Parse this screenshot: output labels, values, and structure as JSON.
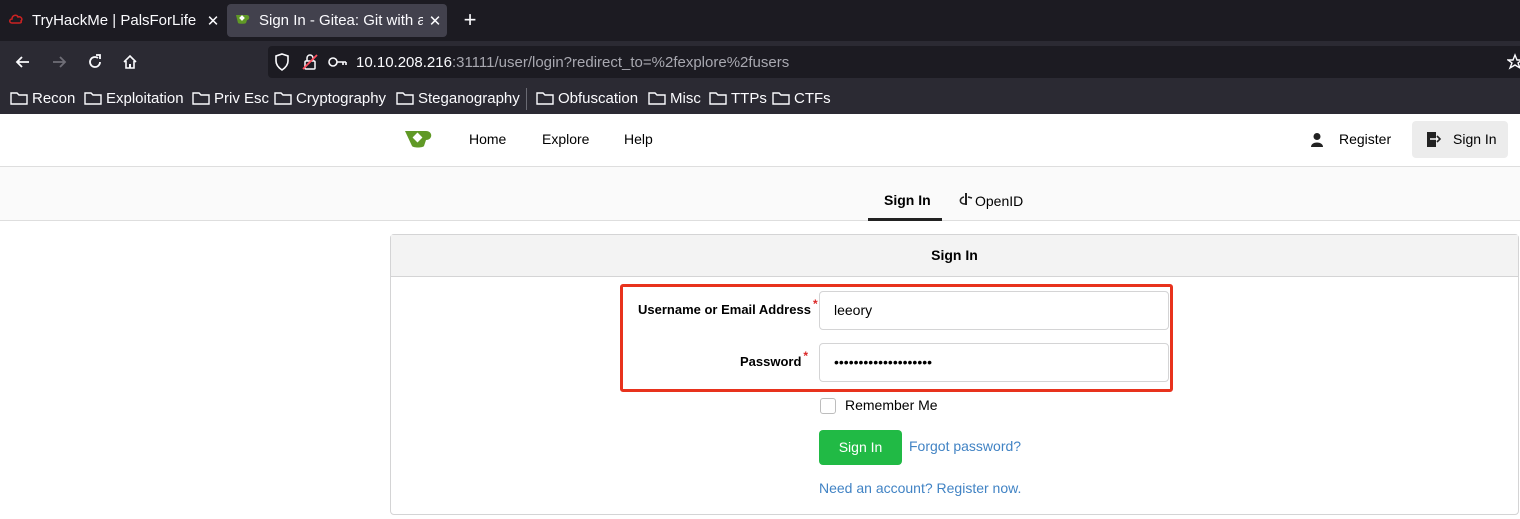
{
  "browser": {
    "tabs": [
      {
        "title": "TryHackMe | PalsForLife",
        "active": false,
        "icon": "tryhackme-cloud-icon"
      },
      {
        "title": "Sign In - Gitea: Git with a cup of tea",
        "active": true,
        "icon": "gitea-icon"
      }
    ],
    "address": {
      "host": "10.10.208.216",
      "rest": ":31111/user/login?redirect_to=%2fexplore%2fusers"
    },
    "bookmarks": [
      "Recon",
      "Exploitation",
      "Priv Esc",
      "Cryptography",
      "Steganography",
      "Obfuscation",
      "Misc",
      "TTPs",
      "CTFs"
    ]
  },
  "gitea": {
    "nav": {
      "home": "Home",
      "explore": "Explore",
      "help": "Help",
      "register": "Register",
      "signin": "Sign In"
    },
    "tabs": {
      "signin": "Sign In",
      "openid": "OpenID"
    },
    "form": {
      "header": "Sign In",
      "username_label": "Username or Email Address",
      "username_value": "leeory",
      "password_label": "Password",
      "password_value": "••••••••••••••••••••",
      "remember": "Remember Me",
      "submit": "Sign In",
      "forgot": "Forgot password?",
      "register": "Need an account? Register now."
    },
    "colors": {
      "accent": "#21ba45",
      "link": "#4183c4",
      "highlight": "#e8321d",
      "brand": "#609926"
    }
  }
}
